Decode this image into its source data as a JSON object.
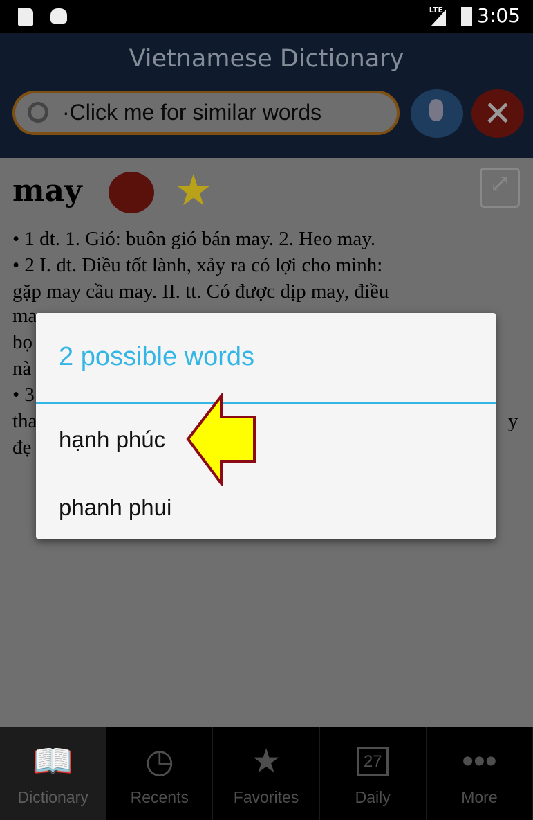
{
  "status": {
    "time": "3:05",
    "network": "LTE",
    "icons": [
      "sd-card-icon",
      "android-icon",
      "signal-icon",
      "battery-charging-icon"
    ]
  },
  "header": {
    "title": "Vietnamese Dictionary",
    "search_value": "·Click me for similar words"
  },
  "entry": {
    "word": "may",
    "lines": [
      "• 1 dt. 1. Gió: buôn gió bán may. 2. Heo may.",
      "• 2 I. dt. Điều tốt lành, xảy ra có lợi cho mình:",
      "gặp may cầu may. II. tt. Có được dịp may, điều"
    ],
    "fragments": [
      "ma",
      "bọ",
      "nà",
      "• 3",
      "tha",
      "đẹ"
    ],
    "fragment_right": "y"
  },
  "dialog": {
    "title": "2 possible words",
    "options": [
      "hạnh phúc",
      "phanh phui"
    ]
  },
  "nav": [
    {
      "label": "Dictionary",
      "icon": "book-icon"
    },
    {
      "label": "Recents",
      "icon": "clock-check-icon"
    },
    {
      "label": "Favorites",
      "icon": "star-icon"
    },
    {
      "label": "Daily",
      "icon": "calendar-icon",
      "day": "27"
    },
    {
      "label": "More",
      "icon": "more-icon"
    }
  ],
  "colors": {
    "accent": "#33b5e5",
    "header": "#1c2e4f",
    "arrow": "#ffff00"
  }
}
